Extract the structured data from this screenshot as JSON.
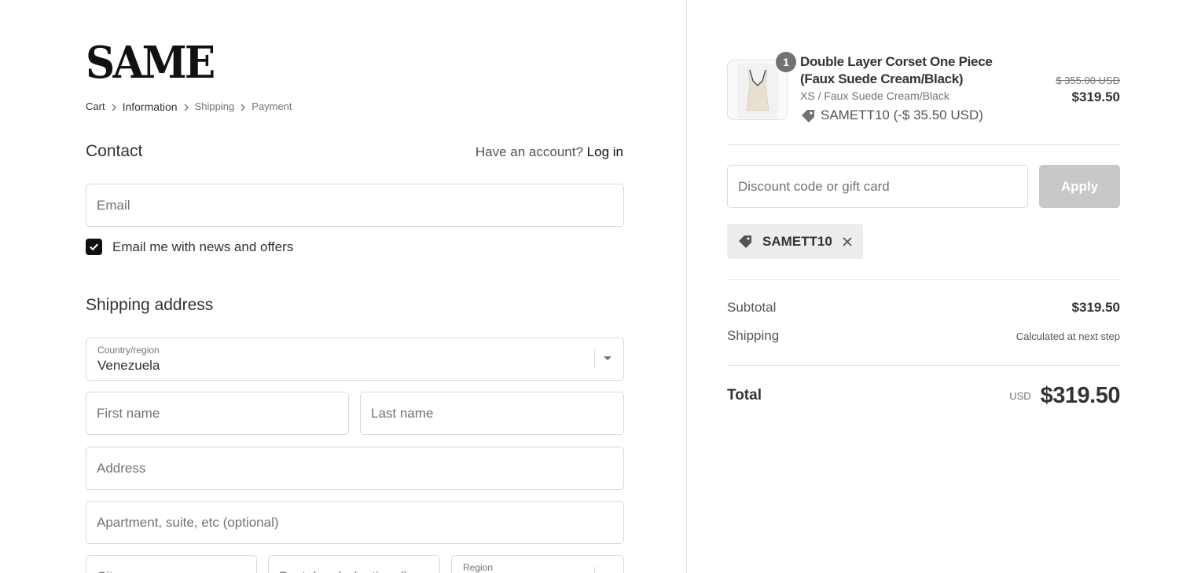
{
  "brand": {
    "logo_text": "SAME"
  },
  "breadcrumb": {
    "items": [
      "Cart",
      "Information",
      "Shipping",
      "Payment"
    ]
  },
  "contact": {
    "title": "Contact",
    "account_prompt": "Have an account?",
    "login_label": "Log in",
    "email_placeholder": "Email",
    "newsletter_label": "Email me with news and offers",
    "newsletter_checked": true
  },
  "shipping": {
    "title": "Shipping address",
    "country_label": "Country/region",
    "country_value": "Venezuela",
    "first_name_placeholder": "First name",
    "last_name_placeholder": "Last name",
    "address_placeholder": "Address",
    "apartment_placeholder": "Apartment, suite, etc (optional)",
    "city_placeholder": "City",
    "postal_placeholder": "Postal code (optional)",
    "region_label": "Region"
  },
  "order": {
    "product": {
      "quantity": "1",
      "title": "Double Layer Corset One Piece (Faux Suede Cream/Black)",
      "variant": "XS / Faux Suede Cream/Black",
      "discount_text": "SAMETT10 (-$ 35.50 USD)",
      "original_price": "$ 355.00 USD",
      "price": "$319.50"
    },
    "discount_placeholder": "Discount code or gift card",
    "apply_label": "Apply",
    "applied_code": "SAMETT10",
    "subtotal_label": "Subtotal",
    "subtotal_value": "$319.50",
    "shipping_label": "Shipping",
    "shipping_value": "Calculated at next step",
    "total_label": "Total",
    "currency": "USD",
    "total_value": "$319.50"
  },
  "colors": {
    "accent": "#111111",
    "button_disabled": "#c8c8c8",
    "chip_bg": "#ededed",
    "border": "#d9d9d9"
  }
}
